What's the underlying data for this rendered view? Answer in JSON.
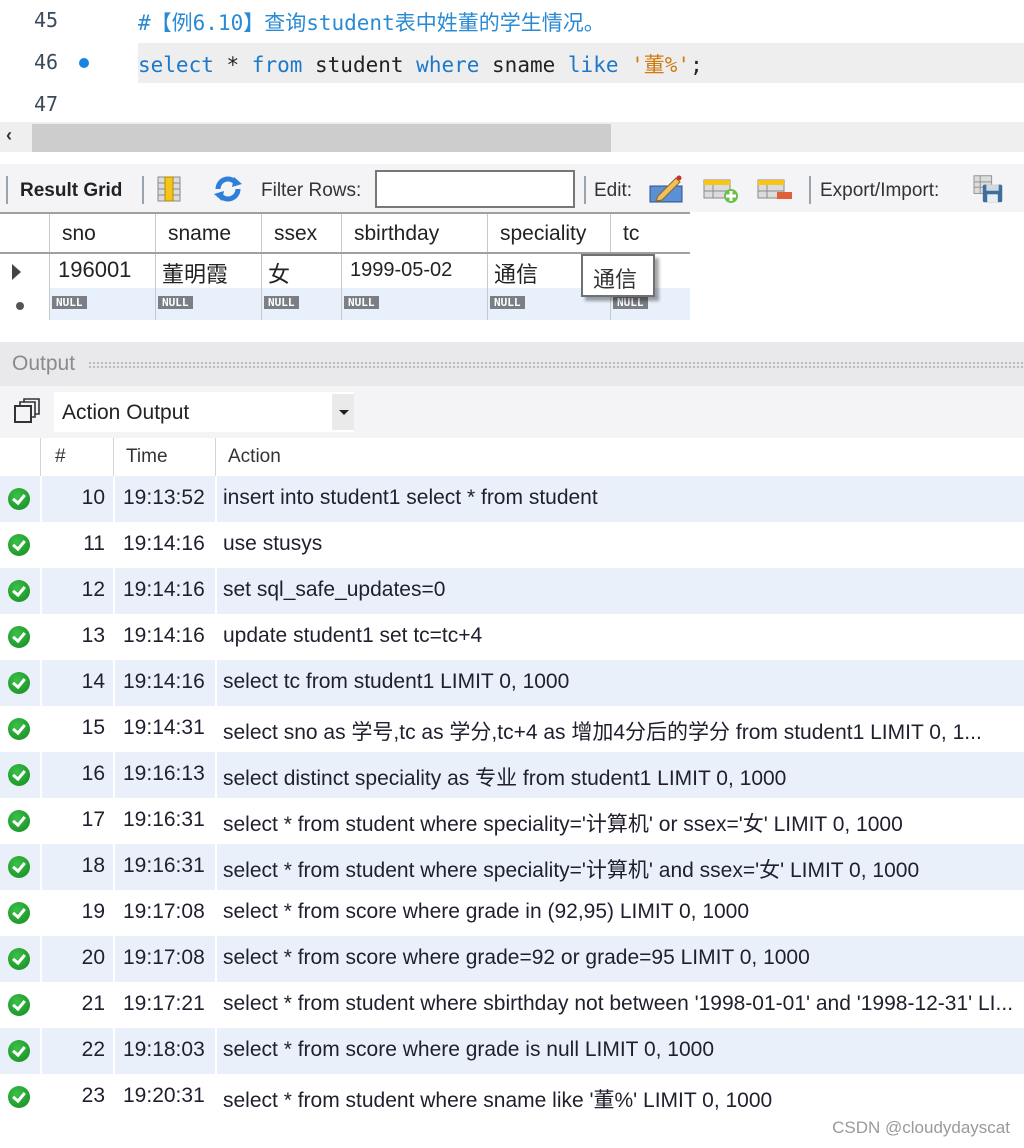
{
  "editor": {
    "lines": [
      {
        "number": "45",
        "text": "#【例6.10】查询student表中姓董的学生情况。",
        "has_marker": false
      },
      {
        "number": "46",
        "has_marker": true,
        "tokens": [
          {
            "t": "select",
            "k": "kw"
          },
          {
            "t": " * ",
            "k": "plain"
          },
          {
            "t": "from",
            "k": "kw"
          },
          {
            "t": " student ",
            "k": "plain"
          },
          {
            "t": "where",
            "k": "kw"
          },
          {
            "t": " sname ",
            "k": "plain"
          },
          {
            "t": "like",
            "k": "kw"
          },
          {
            "t": " ",
            "k": "plain"
          },
          {
            "t": "'董%'",
            "k": "str"
          },
          {
            "t": ";",
            "k": "plain"
          }
        ]
      },
      {
        "number": "47",
        "text": "",
        "has_marker": false
      }
    ],
    "scroll_left_glyph": "‹"
  },
  "result_toolbar": {
    "result_grid_label": "Result Grid",
    "filter_rows_label": "Filter Rows:",
    "filter_value": "",
    "edit_label": "Edit:",
    "export_import_label": "Export/Import:"
  },
  "result_grid": {
    "columns": [
      "sno",
      "sname",
      "ssex",
      "sbirthday",
      "speciality",
      "tc"
    ],
    "rows": [
      [
        "196001",
        "董明霞",
        "女",
        "1999-05-02",
        "通信",
        ""
      ]
    ],
    "new_row_placeholder": "NULL",
    "tooltip": "通信"
  },
  "output": {
    "panel_title": "Output",
    "selector_value": "Action Output",
    "columns": [
      "#",
      "Time",
      "Action"
    ],
    "rows": [
      {
        "n": "10",
        "time": "19:13:52",
        "action": "insert into student1 select * from student",
        "status": "success"
      },
      {
        "n": "11",
        "time": "19:14:16",
        "action": "use stusys",
        "status": "success"
      },
      {
        "n": "12",
        "time": "19:14:16",
        "action": "set sql_safe_updates=0",
        "status": "success"
      },
      {
        "n": "13",
        "time": "19:14:16",
        "action": "update student1 set tc=tc+4",
        "status": "success"
      },
      {
        "n": "14",
        "time": "19:14:16",
        "action": "select tc from student1 LIMIT 0, 1000",
        "status": "success"
      },
      {
        "n": "15",
        "time": "19:14:31",
        "action": "select sno as 学号,tc as 学分,tc+4 as 增加4分后的学分 from student1 LIMIT 0, 1...",
        "status": "success"
      },
      {
        "n": "16",
        "time": "19:16:13",
        "action": "select distinct speciality as 专业 from student1 LIMIT 0, 1000",
        "status": "success"
      },
      {
        "n": "17",
        "time": "19:16:31",
        "action": "select * from student where speciality='计算机' or ssex='女' LIMIT 0, 1000",
        "status": "success"
      },
      {
        "n": "18",
        "time": "19:16:31",
        "action": "select * from student where speciality='计算机' and ssex='女' LIMIT 0, 1000",
        "status": "success"
      },
      {
        "n": "19",
        "time": "19:17:08",
        "action": "select * from score where grade in (92,95) LIMIT 0, 1000",
        "status": "success"
      },
      {
        "n": "20",
        "time": "19:17:08",
        "action": "select * from score where grade=92 or grade=95 LIMIT 0, 1000",
        "status": "success"
      },
      {
        "n": "21",
        "time": "19:17:21",
        "action": "select * from student where sbirthday not between '1998-01-01' and '1998-12-31' LI...",
        "status": "success"
      },
      {
        "n": "22",
        "time": "19:18:03",
        "action": "select * from score where grade is null LIMIT 0, 1000",
        "status": "success"
      },
      {
        "n": "23",
        "time": "19:20:31",
        "action": "select * from student where sname like '董%' LIMIT 0, 1000",
        "status": "success"
      }
    ]
  },
  "watermark": "CSDN @cloudydayscat"
}
